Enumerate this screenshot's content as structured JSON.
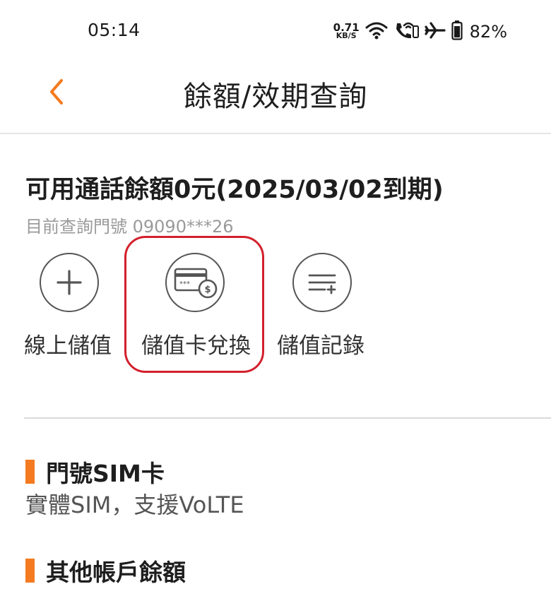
{
  "status_bar": {
    "time": "05:14",
    "net_speed_value": "0.71",
    "net_speed_unit": "KB/S",
    "battery_percent": "82%",
    "icons": [
      "wifi-icon",
      "wifi-call-icon",
      "airplane-mode-icon",
      "battery-icon"
    ]
  },
  "header": {
    "back_icon": "chevron-left-icon",
    "title": "餘額/效期查詢"
  },
  "balance": {
    "title": "可用通話餘額0元(2025/03/02到期)",
    "query_number": "目前查詢門號 09090***26"
  },
  "actions": [
    {
      "label": "線上儲值",
      "icon": "plus-icon"
    },
    {
      "label": "儲值卡兌換",
      "icon": "prepaid-card-icon"
    },
    {
      "label": "儲值記錄",
      "icon": "list-add-icon"
    }
  ],
  "sim_section": {
    "title": "門號SIM卡",
    "value": "實體SIM，支援VoLTE"
  },
  "other_section": {
    "title": "其他帳戶餘額"
  },
  "colors": {
    "accent": "#f47b20",
    "highlight": "#d3202c",
    "divider": "#d9d9d9"
  }
}
